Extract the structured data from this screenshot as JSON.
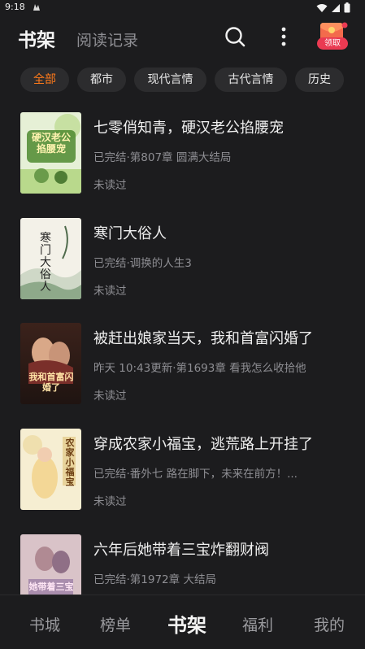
{
  "status_bar": {
    "time": "9:18"
  },
  "header": {
    "tab_active": "书架",
    "tab_other": "阅读记录",
    "gift_label": "领取"
  },
  "filters": [
    {
      "label": "全部",
      "active": true
    },
    {
      "label": "都市",
      "active": false
    },
    {
      "label": "现代言情",
      "active": false
    },
    {
      "label": "古代言情",
      "active": false
    },
    {
      "label": "历史",
      "active": false
    }
  ],
  "books": [
    {
      "title": "七零俏知青，硬汉老公掐腰宠",
      "meta": "已完结·第807章 圆满大结局",
      "read_status": "未读过",
      "cover_text": "硬汉老公掐腰宠",
      "cover_colors": [
        "#dfeccb",
        "#a9cf7f",
        "#5a8b3a"
      ]
    },
    {
      "title": "寒门大俗人",
      "meta": "已完结·调换的人生3",
      "read_status": "未读过",
      "cover_text": "寒门大俗人",
      "cover_colors": [
        "#f3f1e8",
        "#e3e6dc",
        "#6f8a6c"
      ]
    },
    {
      "title": "被赶出娘家当天，我和首富闪婚了",
      "meta": "昨天 10:43更新·第1693章 看我怎么收拾他",
      "read_status": "未读过",
      "cover_text": "我和首富闪婚了",
      "cover_colors": [
        "#2a1a16",
        "#6b3a2a",
        "#b98a5a"
      ]
    },
    {
      "title": "穿成农家小福宝，逃荒路上开挂了",
      "meta": "已完结·番外七 路在脚下，未来在前方！...",
      "read_status": "未读过",
      "cover_text": "农家小福宝",
      "cover_colors": [
        "#f6eed2",
        "#e8d7a4",
        "#c79b4a"
      ]
    },
    {
      "title": "六年后她带着三宝炸翻财阀",
      "meta": "已完结·第1972章 大结局",
      "read_status": "",
      "cover_text": "她带着三宝",
      "cover_colors": [
        "#d9c3c8",
        "#9c7d92",
        "#5a4763"
      ]
    }
  ],
  "bottom_nav": [
    {
      "label": "书城",
      "active": false
    },
    {
      "label": "榜单",
      "active": false
    },
    {
      "label": "书架",
      "active": true
    },
    {
      "label": "福利",
      "active": false
    },
    {
      "label": "我的",
      "active": false
    }
  ],
  "colors": {
    "background": "#1c1c1e",
    "accent": "#ff7a1a",
    "chip_bg": "#2c2c2e",
    "gift_red": "#ea3a52"
  }
}
